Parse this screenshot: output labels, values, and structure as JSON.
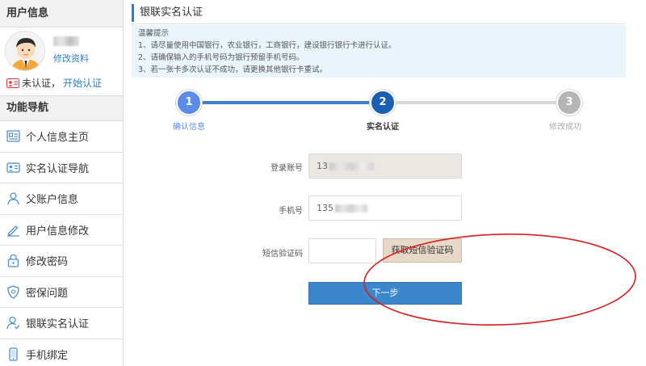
{
  "sidebar": {
    "user_header": "用户信息",
    "edit_profile": "修改资料",
    "auth_status": "未认证，",
    "auth_link": "开始认证",
    "nav_header": "功能导航",
    "items": [
      {
        "label": "个人信息主页",
        "icon": "home-card-icon"
      },
      {
        "label": "实名认证导航",
        "icon": "id-card-icon"
      },
      {
        "label": "父账户信息",
        "icon": "user-icon"
      },
      {
        "label": "用户信息修改",
        "icon": "pencil-icon"
      },
      {
        "label": "修改密码",
        "icon": "lock-icon"
      },
      {
        "label": "密保问题",
        "icon": "shield-icon"
      },
      {
        "label": "银联实名认证",
        "icon": "user-check-icon"
      },
      {
        "label": "手机绑定",
        "icon": "phone-icon"
      }
    ]
  },
  "main": {
    "title": "银联实名认证",
    "tips": {
      "heading": "温馨提示",
      "lines": [
        "1、请尽量使用中国银行，农业银行，工商银行，建设银行银行卡进行认证。",
        "2、请确保输入的手机号码为银行预留手机号码。",
        "3、若一张卡多次认证不成功，请更换其他银行卡重试。"
      ]
    },
    "steps": [
      {
        "num": "1",
        "label": "确认信息",
        "state": "done"
      },
      {
        "num": "2",
        "label": "实名认证",
        "state": "active"
      },
      {
        "num": "3",
        "label": "修改成功",
        "state": "todo"
      }
    ],
    "form": {
      "account_label": "登录账号",
      "account_value": "13",
      "phone_label": "手机号",
      "phone_value": "135",
      "sms_label": "短信验证码",
      "sms_value": "",
      "sms_button": "获取短信验证码",
      "next_button": "下一步"
    }
  },
  "colors": {
    "accent": "#2c7fc7",
    "step_done": "#5b8ce8",
    "step_active": "#1a5fb4",
    "step_todo": "#b5b5b5",
    "highlight_ellipse": "#d42020"
  }
}
